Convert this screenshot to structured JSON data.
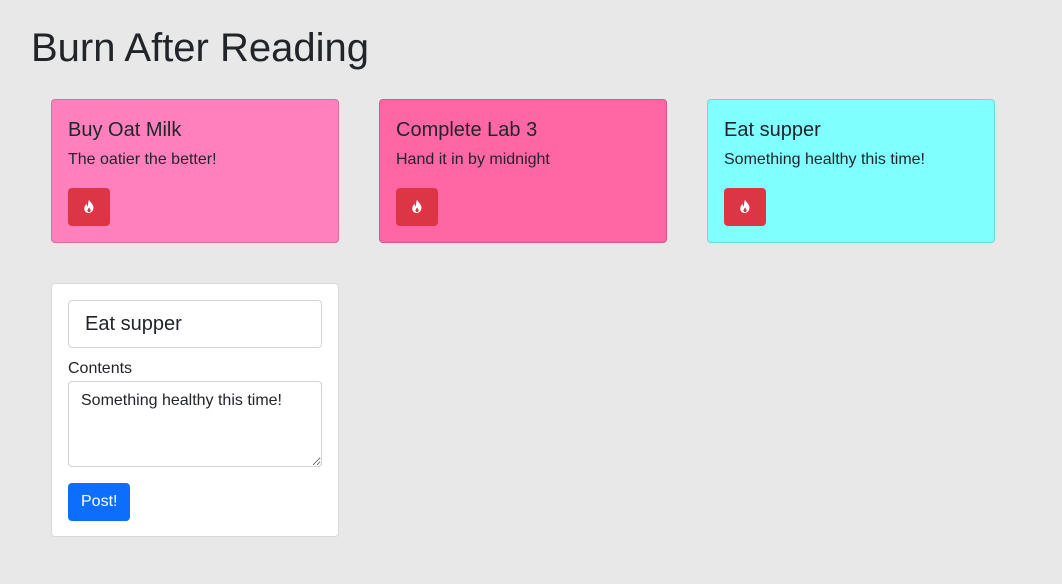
{
  "page": {
    "title": "Burn After Reading"
  },
  "notes": [
    {
      "title": "Buy Oat Milk",
      "body": "The oatier the better!",
      "color": "#ff80bd",
      "burn_icon": "fire-icon"
    },
    {
      "title": "Complete Lab 3",
      "body": "Hand it in by midnight",
      "color": "#ff66a3",
      "burn_icon": "fire-icon"
    },
    {
      "title": "Eat supper",
      "body": "Something healthy this time!",
      "color": "#80ffff",
      "burn_icon": "fire-icon"
    }
  ],
  "form": {
    "title_value": "Eat supper",
    "contents_label": "Contents",
    "contents_value": "Something healthy this time!",
    "post_label": "Post!"
  },
  "colors": {
    "burn": "#dc3545",
    "primary": "#0d6efd",
    "background": "#e8e8e8"
  }
}
